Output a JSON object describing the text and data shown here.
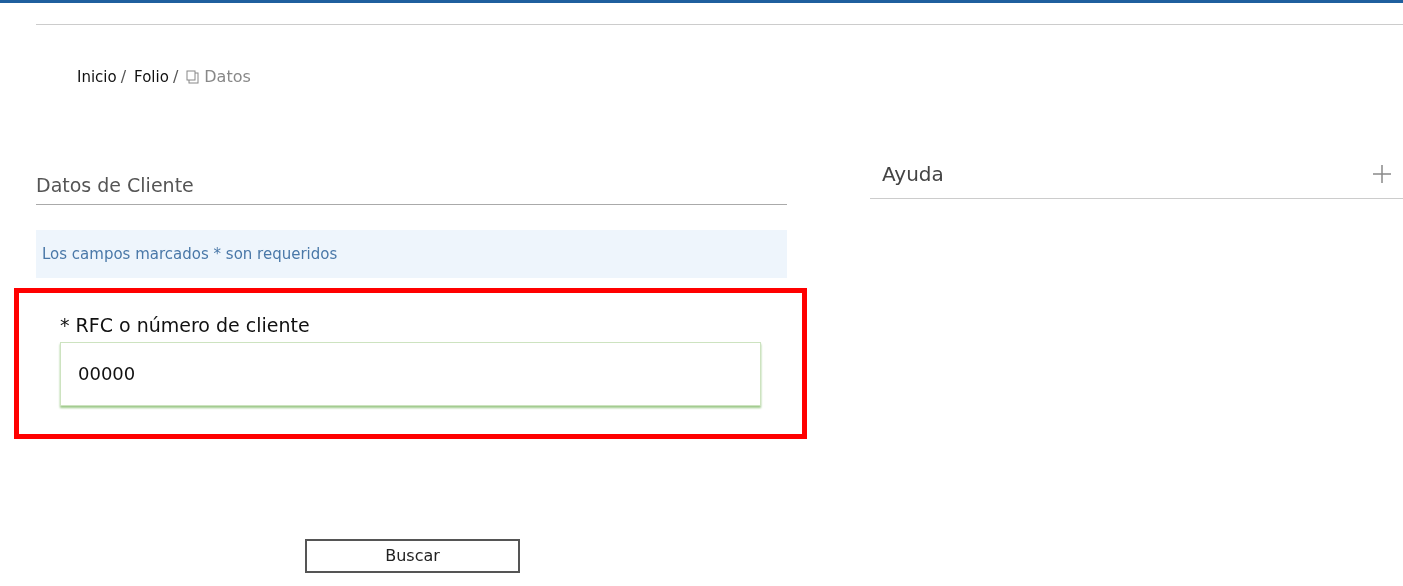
{
  "breadcrumb": {
    "separator": "/",
    "items": [
      {
        "label": "Inicio",
        "current": false
      },
      {
        "label": "Folio",
        "current": false
      },
      {
        "label": "Datos",
        "current": true
      }
    ]
  },
  "client_section": {
    "title": "Datos de Cliente",
    "notice": "Los campos marcados * son requeridos",
    "field": {
      "label": "* RFC o número de cliente",
      "value": "00000",
      "highlighted": true
    }
  },
  "help_panel": {
    "title": "Ayuda",
    "expanded": false
  },
  "buttons": [
    "Buscar"
  ]
}
